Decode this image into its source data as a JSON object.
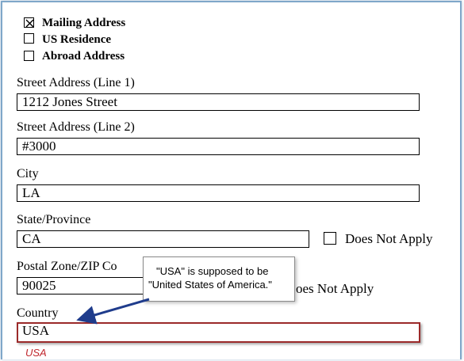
{
  "address_type": {
    "options": [
      {
        "label": "Mailing Address",
        "checked": true
      },
      {
        "label": "US Residence",
        "checked": false
      },
      {
        "label": "Abroad Address",
        "checked": false
      }
    ]
  },
  "fields": {
    "street1": {
      "label": "Street Address (Line 1)",
      "value": "1212 Jones Street"
    },
    "street2": {
      "label": "Street Address (Line 2)",
      "value": "#3000"
    },
    "city": {
      "label": "City",
      "value": "LA"
    },
    "state": {
      "label": "State/Province",
      "value": "CA",
      "does_not_apply_label": "Does Not Apply"
    },
    "postal": {
      "label": "Postal Zone/ZIP Co",
      "value": "90025",
      "does_not_apply_label": "oes Not Apply"
    },
    "country": {
      "label": "Country",
      "value": "USA",
      "hint": "USA"
    }
  },
  "callout": {
    "line1": "\"USA\" is supposed to be",
    "line2": "\"United States of America.\""
  },
  "colors": {
    "error_border": "#9b2a2a",
    "hint_text": "#c0272d",
    "arrow": "#1f3c8c",
    "frame": "#7fa7c9"
  }
}
